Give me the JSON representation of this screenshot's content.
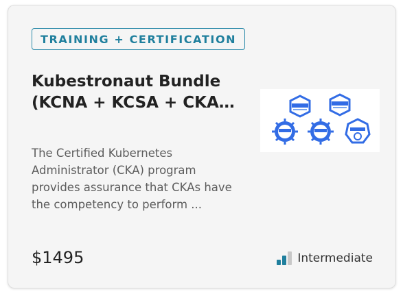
{
  "card": {
    "badge": "TRAINING + CERTIFICATION",
    "title": "Kubestronaut Bundle (KCNA + KCSA + CKA + CKAD + CKS)",
    "description": "The Certified Kubernetes Administrator (CKA) program provides assurance that CKAs have the competency to perform ...",
    "price": "$1495",
    "level": {
      "label": "Intermediate",
      "filled_bars": 2,
      "total_bars": 3
    },
    "image": {
      "badges": [
        "kubernetes-badge",
        "kubernetes-security-badge",
        "certified-kubernetes-badge",
        "certified-kubernetes-badge",
        "kubernetes-heptagon-badge"
      ]
    }
  },
  "colors": {
    "accent": "#2b8aa9",
    "kubernetes_blue": "#326ce5",
    "bar_filled": "#1f7f9d",
    "bar_empty": "#c8c8c8",
    "card_bg": "#f5f5f5"
  }
}
